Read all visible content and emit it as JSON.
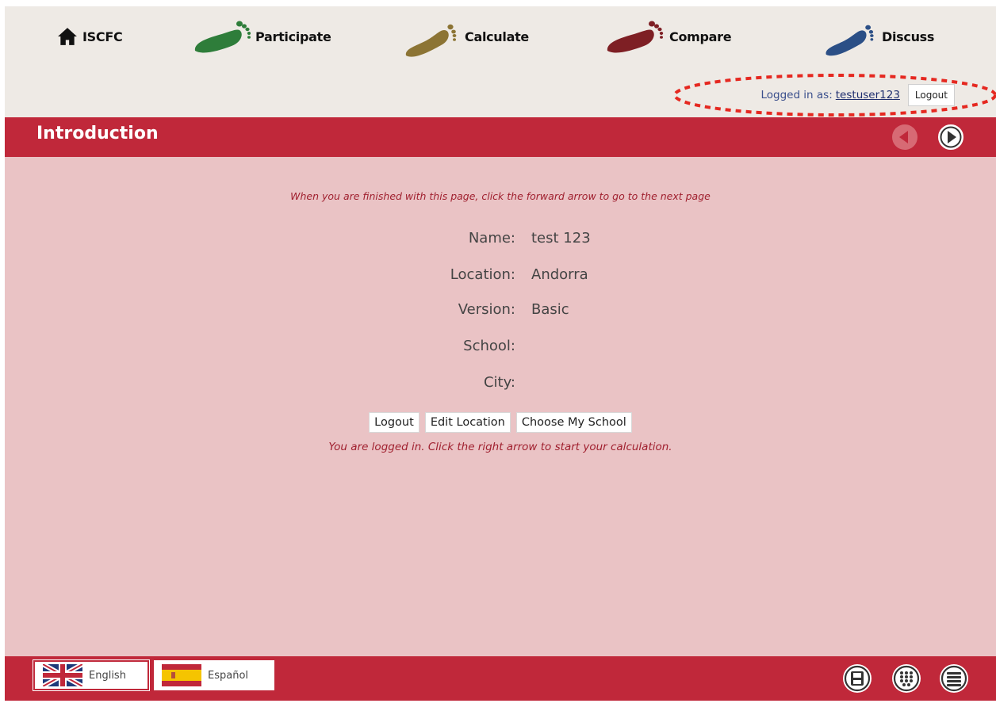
{
  "nav": {
    "home": {
      "label": "ISCFC",
      "icon": "home-icon"
    },
    "items": [
      {
        "label": "Participate",
        "icon": "footprint-icon",
        "color": "#2e7d3a"
      },
      {
        "label": "Calculate",
        "icon": "footprint-icon",
        "color": "#8c7434"
      },
      {
        "label": "Compare",
        "icon": "footprint-icon",
        "color": "#7e1f24"
      },
      {
        "label": "Discuss",
        "icon": "footprint-icon",
        "color": "#2b4f86"
      }
    ]
  },
  "login": {
    "prefix": "Logged in as:",
    "username": "testuser123",
    "logout_label": "Logout",
    "highlight_color": "#e52820"
  },
  "header": {
    "title": "Introduction",
    "back_icon": "back-arrow-icon",
    "forward_icon": "forward-arrow-icon",
    "bar_color": "#c0283a"
  },
  "main": {
    "instruction": "When you are finished with this page, click the forward arrow to go to the next page",
    "fields": [
      {
        "label": "Name:",
        "value": "test 123"
      },
      {
        "label": "Location:",
        "value": "Andorra"
      },
      {
        "label": "Version:",
        "value": "Basic"
      },
      {
        "label": "School:",
        "value": ""
      },
      {
        "label": "City:",
        "value": ""
      }
    ],
    "buttons": {
      "logout": "Logout",
      "edit_location": "Edit Location",
      "choose_school": "Choose My School"
    },
    "status_message": "You are logged in. Click the right arrow to start your calculation."
  },
  "footer": {
    "languages": [
      {
        "label": "English",
        "icon": "uk-flag-icon",
        "selected": true
      },
      {
        "label": "Español",
        "icon": "spain-flag-icon",
        "selected": false
      }
    ],
    "icons": [
      "save-icon",
      "grid-icon",
      "list-icon"
    ]
  }
}
